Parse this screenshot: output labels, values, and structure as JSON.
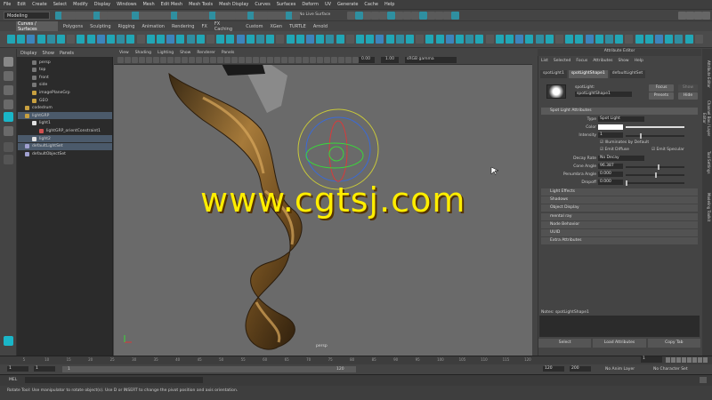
{
  "menu": [
    "File",
    "Edit",
    "Create",
    "Select",
    "Modify",
    "Display",
    "Windows",
    "Mesh",
    "Edit Mesh",
    "Mesh Tools",
    "Mesh Display",
    "Curves",
    "Surfaces",
    "Deform",
    "UV",
    "Generate",
    "Cache",
    "Help"
  ],
  "status": {
    "workspace": "Modeling",
    "live_surface": "No Live Surface"
  },
  "shelf_tabs": [
    "Curves / Surfaces",
    "Polygons",
    "Sculpting",
    "Rigging",
    "Animation",
    "Rendering",
    "FX",
    "FX Caching",
    "Custom",
    "XGen",
    "TURTLE",
    "Arnold"
  ],
  "outliner": {
    "menu": [
      "Display",
      "Show",
      "Panels"
    ],
    "items": [
      {
        "label": "persp",
        "indent": 2,
        "sel": false,
        "icon": "camera-icon"
      },
      {
        "label": "top",
        "indent": 2,
        "sel": false,
        "icon": "camera-icon"
      },
      {
        "label": "front",
        "indent": 2,
        "sel": false,
        "icon": "camera-icon"
      },
      {
        "label": "side",
        "indent": 2,
        "sel": false,
        "icon": "camera-icon"
      },
      {
        "label": "imagePlaneGrp",
        "indent": 2,
        "sel": false,
        "icon": "group-icon"
      },
      {
        "label": "GEO",
        "indent": 2,
        "sel": false,
        "icon": "group-icon"
      },
      {
        "label": "codedrum",
        "indent": 1,
        "sel": false,
        "icon": "group-icon"
      },
      {
        "label": "lightGRP",
        "indent": 1,
        "sel": true,
        "icon": "group-icon"
      },
      {
        "label": "light1",
        "indent": 2,
        "sel": false,
        "icon": "light-icon"
      },
      {
        "label": "lightGRP_orientConstraint1",
        "indent": 3,
        "sel": false,
        "icon": "constraint-icon"
      },
      {
        "label": "light2",
        "indent": 2,
        "sel": true,
        "icon": "light-icon"
      },
      {
        "label": "defaultLightSet",
        "indent": 1,
        "sel": true,
        "icon": "set-icon"
      },
      {
        "label": "defaultObjectSet",
        "indent": 1,
        "sel": false,
        "icon": "set-icon"
      }
    ]
  },
  "viewport": {
    "menu": [
      "View",
      "Shading",
      "Lighting",
      "Show",
      "Renderer",
      "Panels"
    ],
    "field1": "0.00",
    "field2": "1.00",
    "color_space": "sRGB gamma",
    "camera_label": "persp"
  },
  "watermark": "www.cgtsj.com",
  "attr": {
    "title": "Attribute Editor",
    "menu": [
      "List",
      "Selected",
      "Focus",
      "Attributes",
      "Show",
      "Help"
    ],
    "tabs": [
      "spotLight1",
      "spotLightShape1",
      "defaultLightSet"
    ],
    "node_label": "spotLight:",
    "node_name": "spotLightShape1",
    "focus": "Focus",
    "presets": "Presets",
    "show": "Show",
    "hide": "Hide",
    "section_main": "Spot Light Attributes",
    "type_label": "Type",
    "type_value": "Spot Light",
    "color_label": "Color",
    "intensity_label": "Intensity",
    "intensity_value": "1",
    "illum_default": "Illuminates by Default",
    "emit_diffuse": "Emit Diffuse",
    "emit_specular": "Emit Specular",
    "decay_label": "Decay Rate",
    "decay_value": "No Decay",
    "cone_label": "Cone Angle",
    "cone_value": "96.387",
    "penumbra_label": "Penumbra Angle",
    "penumbra_value": "0.000",
    "dropoff_label": "Dropoff",
    "dropoff_value": "0.000",
    "sections": [
      "Light Effects",
      "Shadows",
      "Object Display",
      "mental ray",
      "Node Behavior",
      "UUID",
      "Extra Attributes"
    ],
    "notes": "Notes: spotLightShape1",
    "footer": [
      "Select",
      "Load Attributes",
      "Copy Tab"
    ]
  },
  "side_tabs": [
    "Attribute Editor",
    "Channel Box / Layer Editor",
    "Tool Settings",
    "Modeling Toolkit"
  ],
  "timeline": {
    "ticks": [
      "5",
      "10",
      "15",
      "20",
      "25",
      "30",
      "35",
      "40",
      "45",
      "50",
      "55",
      "60",
      "65",
      "70",
      "75",
      "80",
      "85",
      "90",
      "95",
      "100",
      "105",
      "110",
      "115",
      "120"
    ],
    "current": "1"
  },
  "range": {
    "start": "1",
    "start2": "1",
    "inner_start": "1",
    "inner_end": "120",
    "end": "120",
    "end2": "200",
    "anim_layer": "No Anim Layer",
    "char_set": "No Character Set"
  },
  "cmd": {
    "label": "MEL"
  },
  "help": "Rotate Tool: Use manipulator to rotate object(s). Use D or INSERT to change the pivot position and axis orientation.",
  "colors": {
    "accent_cyan": "#1ab6c8",
    "hair_brown": "#7a5320",
    "watermark": "#ffee00"
  }
}
